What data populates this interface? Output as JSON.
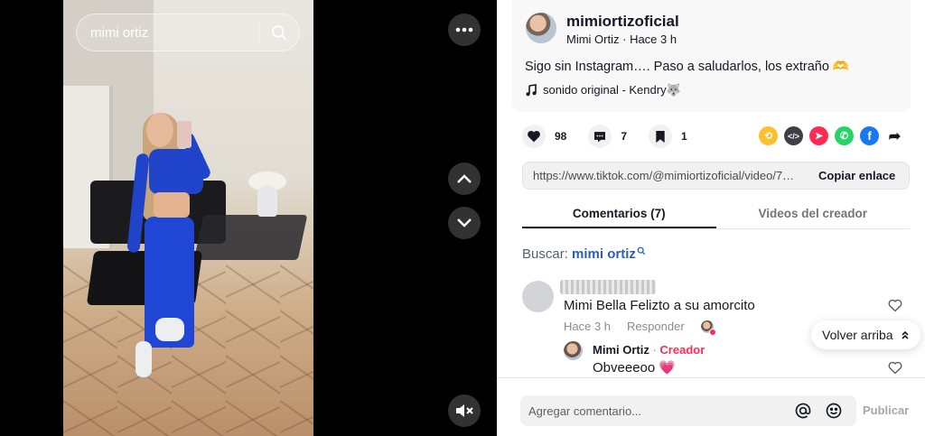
{
  "search": {
    "query": "mimi ortiz"
  },
  "video_controls": {
    "more_icon": "more-icon",
    "prev_icon": "chevron-up-icon",
    "next_icon": "chevron-down-icon",
    "mute_icon": "mute-icon"
  },
  "post": {
    "username": "mimiortizoficial",
    "display_name": "Mimi Ortiz",
    "time": "Hace 3 h",
    "separator": " · ",
    "caption": "Sigo sin Instagram…. Paso a saludarlos, los extraño 🫶",
    "sound": "sonido original - Kendry🐺"
  },
  "actions": {
    "likes": "98",
    "comments": "7",
    "saves": "1"
  },
  "share_icons": [
    {
      "name": "repost-icon",
      "color": "#fcc02c"
    },
    {
      "name": "embed-icon",
      "color": "#3f3f45"
    },
    {
      "name": "send-icon",
      "color": "#fe2c55"
    },
    {
      "name": "whatsapp-icon",
      "color": "#25d366"
    },
    {
      "name": "facebook-icon",
      "color": "#1877f2"
    },
    {
      "name": "share-arrow-icon",
      "color": "#161823"
    }
  ],
  "link": {
    "url": "https://www.tiktok.com/@mimiortizoficial/video/75...",
    "copy_label": "Copiar enlace"
  },
  "tabs": {
    "comments": "Comentarios (7)",
    "creator_videos": "Videos del creador"
  },
  "comment_search": {
    "label": "Buscar: ",
    "query": "mimi ortiz"
  },
  "comments": {
    "c1": {
      "text": "Mimi Bella Felizto a su amorcito",
      "time": "Hace 3 h",
      "reply": "Responder"
    },
    "r1": {
      "name": "Mimi Ortiz",
      "sep": " · ",
      "badge": "Creador",
      "text": "Obveeeoo 💗"
    }
  },
  "back_to_top": "Volver arriba",
  "composer": {
    "placeholder": "Agregar comentario...",
    "post": "Publicar"
  },
  "colors": {
    "accent": "#fe2c55",
    "link_blue": "#2b5db9"
  }
}
